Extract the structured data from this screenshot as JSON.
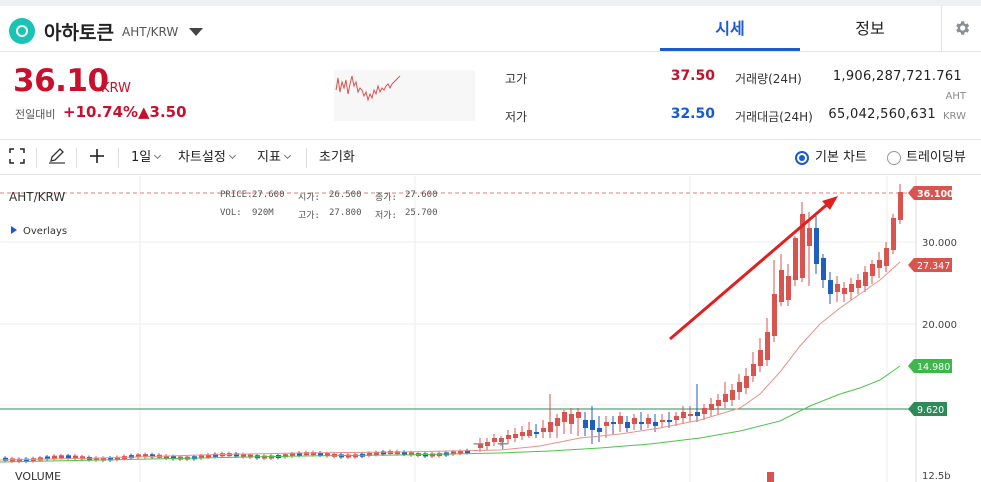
{
  "header": {
    "coin_name": "아하토큰",
    "pair": "AHT/KRW",
    "tabs": [
      {
        "label": "시세",
        "active": true
      },
      {
        "label": "정보",
        "active": false
      }
    ],
    "settings_icon": "gear-icon"
  },
  "price": {
    "current": "36.10",
    "unit": "KRW",
    "change_label": "전일대비",
    "change_pct": "+10.74%",
    "change_abs": "▲3.50"
  },
  "stats": {
    "high_label": "고가",
    "high_value": "37.50",
    "low_label": "저가",
    "low_value": "32.50",
    "volume_label": "거래량(24H)",
    "volume_value": "1,906,287,721.761",
    "volume_unit": "AHT",
    "amount_label": "거래대금(24H)",
    "amount_value": "65,042,560,631",
    "amount_unit": "KRW"
  },
  "toolbar": {
    "interval": "1일",
    "chart_settings": "차트설정",
    "indicators": "지표",
    "reset": "초기화",
    "basic_chart": "기본 차트",
    "tradingview": "트레이딩뷰",
    "basic_selected": true
  },
  "chart": {
    "symbol": "AHT/KRW",
    "ohlc": {
      "price_label": "PRICE:",
      "price": "27.600",
      "open_label": "시가:",
      "open": "26.500",
      "close_label": "종가:",
      "close": "27.600",
      "vol_label": "VOL:",
      "vol": "920M",
      "high_label": "고가:",
      "high": "27.800",
      "low_label": "저가:",
      "low": "25.700"
    },
    "overlays_label": "Overlays",
    "volume_label": "VOLUME",
    "axis_ticks": [
      "30.000",
      "20.000",
      "12.5b"
    ],
    "price_tags": [
      {
        "label": "36.100",
        "color": "#d9534f"
      },
      {
        "label": "27.347",
        "color": "#d9534f"
      },
      {
        "label": "14.980",
        "color": "#3cb84a"
      },
      {
        "label": "9.620",
        "color": "#2e8b57"
      }
    ],
    "colors": {
      "up": "#d9534f",
      "down": "#1f5fbf",
      "ma_short": "#e8908a",
      "ma_long": "#4cc44c",
      "arrow": "#e02020"
    }
  }
}
